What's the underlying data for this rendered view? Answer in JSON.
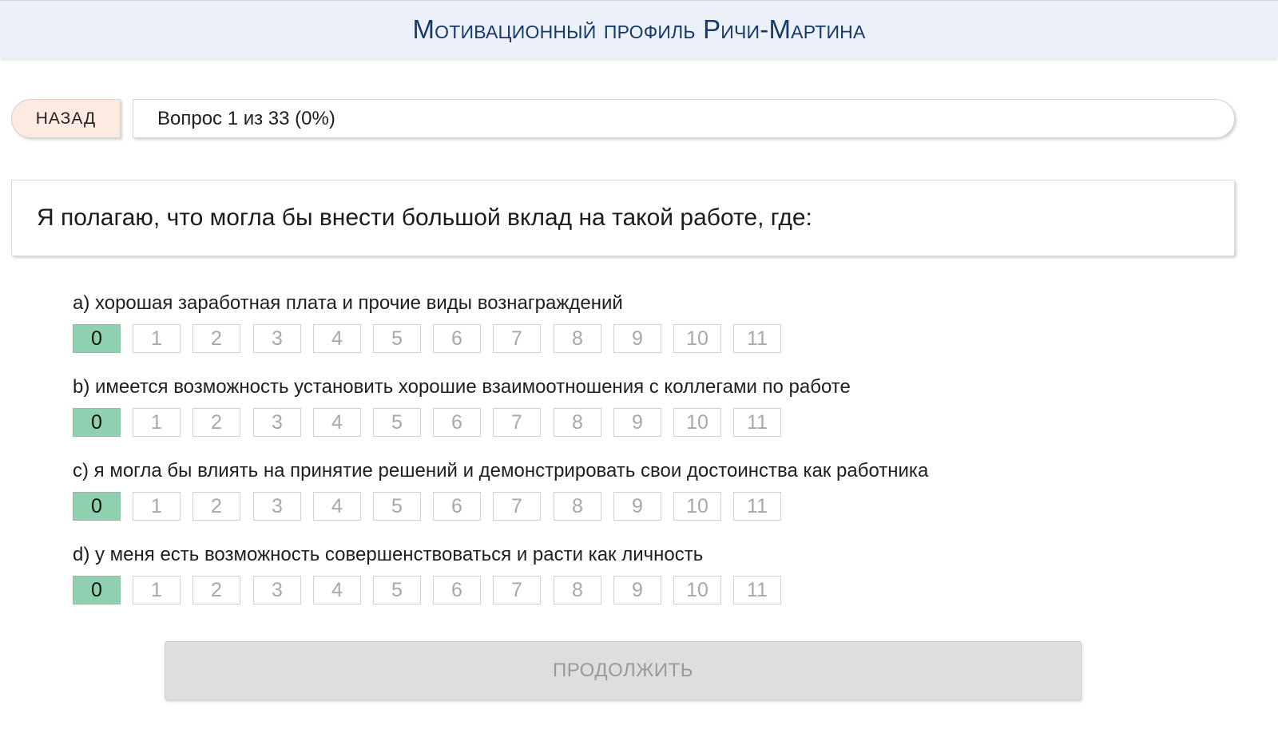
{
  "header": {
    "title": "Мотивационный профиль Ричи-Мартина"
  },
  "nav": {
    "back_label": "НАЗАД",
    "progress_text": "Вопрос 1 из 33 (0%)"
  },
  "question": {
    "text": "Я полагаю, что могла бы внести большой вклад на такой работе, где:"
  },
  "options": [
    {
      "label": "a) хорошая заработная плата и прочие виды вознаграждений",
      "scale": [
        "0",
        "1",
        "2",
        "3",
        "4",
        "5",
        "6",
        "7",
        "8",
        "9",
        "10",
        "11"
      ],
      "selected": "0"
    },
    {
      "label": "b) имеется возможность установить хорошие взаимоотношения с коллегами по работе",
      "scale": [
        "0",
        "1",
        "2",
        "3",
        "4",
        "5",
        "6",
        "7",
        "8",
        "9",
        "10",
        "11"
      ],
      "selected": "0"
    },
    {
      "label": "c) я могла бы влиять на принятие решений и демонстрировать свои достоинства как работника",
      "scale": [
        "0",
        "1",
        "2",
        "3",
        "4",
        "5",
        "6",
        "7",
        "8",
        "9",
        "10",
        "11"
      ],
      "selected": "0"
    },
    {
      "label": "d) у меня есть возможность совершенствоваться и расти как личность",
      "scale": [
        "0",
        "1",
        "2",
        "3",
        "4",
        "5",
        "6",
        "7",
        "8",
        "9",
        "10",
        "11"
      ],
      "selected": "0"
    }
  ],
  "footer": {
    "continue_label": "ПРОДОЛЖИТЬ"
  },
  "colors": {
    "header_bg": "#ecf1f8",
    "title_color": "#153a6b",
    "back_bg": "#fdebe1",
    "selected_bg": "#8fd0b0",
    "continue_bg": "#dedede"
  }
}
